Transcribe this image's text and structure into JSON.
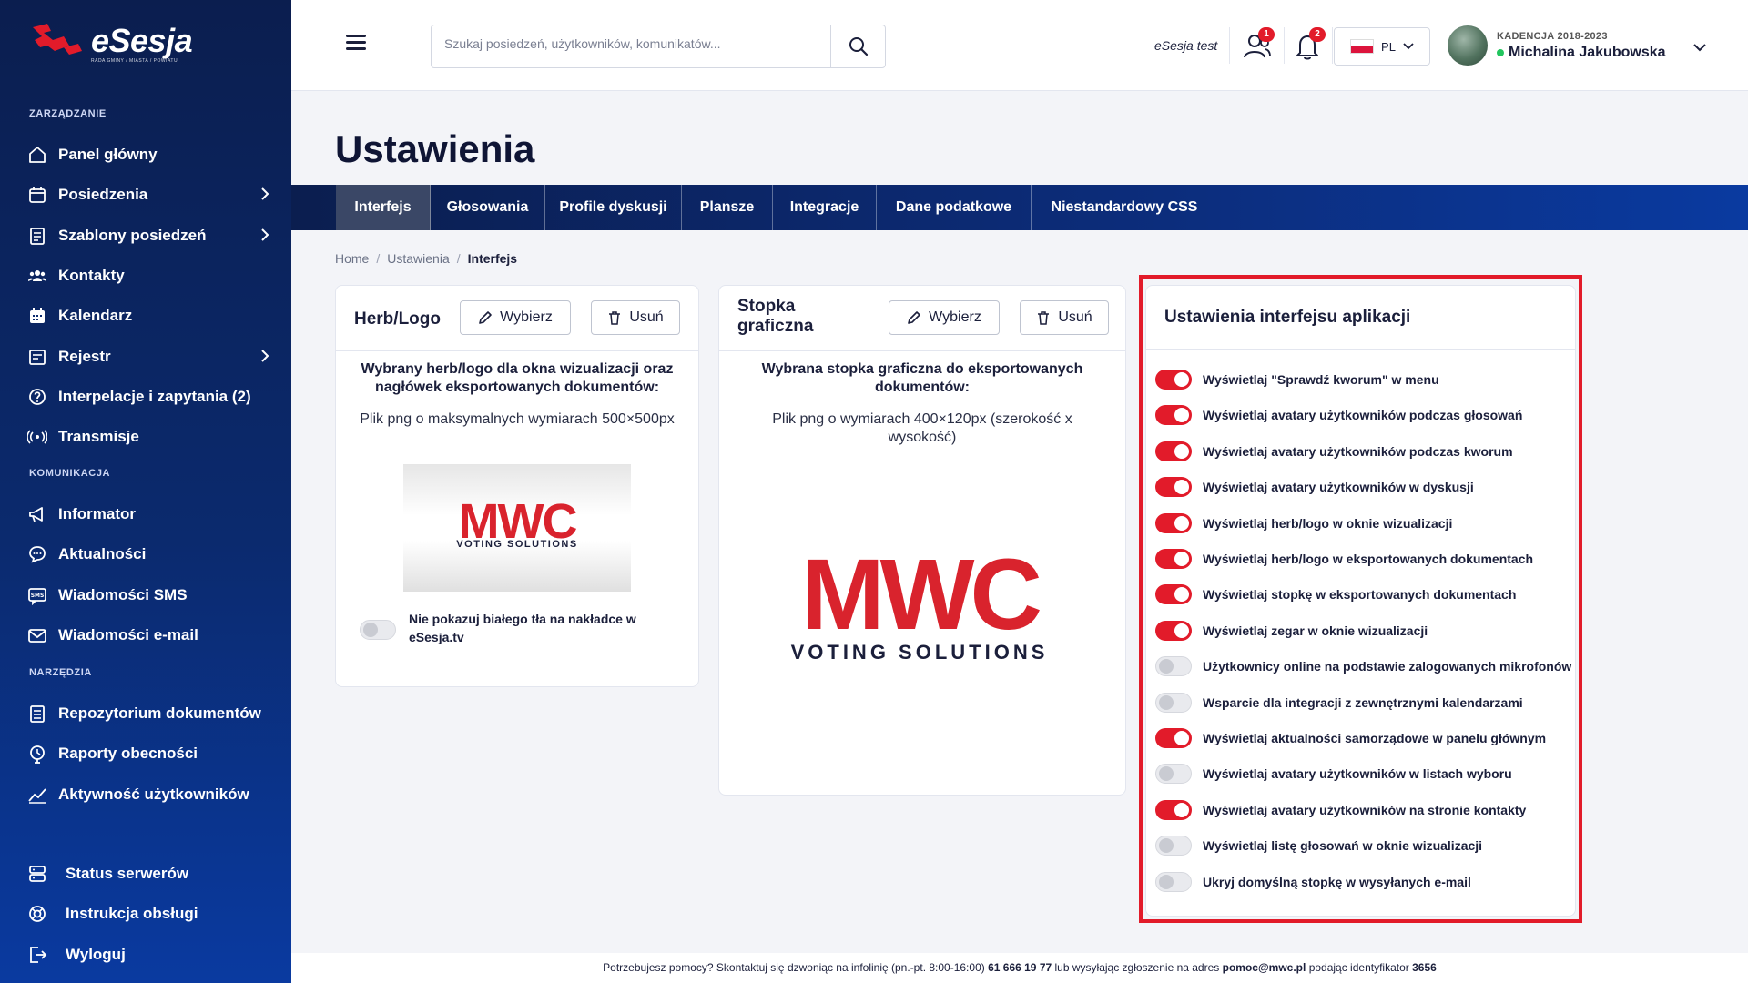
{
  "brand": {
    "name": "eSesja",
    "tagline": "RADA GMINY / MIASTA / POWIATU"
  },
  "sidebar": {
    "sections": [
      "ZARZĄDZANIE",
      "KOMUNIKACJA",
      "NARZĘDZIA"
    ],
    "management": [
      {
        "label": "Panel główny",
        "icon": "home-icon"
      },
      {
        "label": "Posiedzenia",
        "icon": "calendar-icon"
      },
      {
        "label": "Szablony posiedzeń",
        "icon": "template-icon"
      },
      {
        "label": "Kontakty",
        "icon": "contacts-icon"
      },
      {
        "label": "Kalendarz",
        "icon": "calendar-grid-icon"
      },
      {
        "label": "Rejestr",
        "icon": "register-icon"
      },
      {
        "label": "Interpelacje i zapytania (2)",
        "icon": "question-icon"
      },
      {
        "label": "Transmisje",
        "icon": "broadcast-icon"
      }
    ],
    "communication": [
      {
        "label": "Informator",
        "icon": "megaphone-icon"
      },
      {
        "label": "Aktualności",
        "icon": "chat-icon"
      },
      {
        "label": "Wiadomości SMS",
        "icon": "sms-icon"
      },
      {
        "label": "Wiadomości e-mail",
        "icon": "mail-icon"
      }
    ],
    "tools": [
      {
        "label": "Repozytorium dokumentów",
        "icon": "document-icon"
      },
      {
        "label": "Raporty obecności",
        "icon": "report-icon"
      },
      {
        "label": "Aktywność użytkowników",
        "icon": "chart-icon"
      }
    ],
    "bottom": [
      {
        "label": "Status serwerów",
        "icon": "server-icon"
      },
      {
        "label": "Instrukcja obsługi",
        "icon": "help-icon"
      },
      {
        "label": "Wyloguj",
        "icon": "logout-icon"
      }
    ]
  },
  "header": {
    "search_placeholder": "Szukaj posiedzeń, użytkowników, komunikatów...",
    "env_label": "eSesja test",
    "users_badge": "1",
    "notif_badge": "2",
    "lang": "PL",
    "user_term": "KADENCJA 2018-2023",
    "user_name": "Michalina Jakubowska"
  },
  "page": {
    "title": "Ustawienia",
    "tabs": [
      "Interfejs",
      "Głosowania",
      "Profile dyskusji",
      "Plansze",
      "Integracje",
      "Dane podatkowe",
      "Niestandardowy CSS"
    ],
    "active_tab": "Interfejs",
    "breadcrumb": [
      "Home",
      "Ustawienia",
      "Interfejs"
    ]
  },
  "logo_card": {
    "title": "Herb/Logo",
    "choose": "Wybierz",
    "remove": "Usuń",
    "desc_bold": "Wybrany herb/logo dla okna wizualizacji oraz nagłówek eksportowanych dokumentów:",
    "desc": "Plik png o maksymalnych wymiarach 500×500px",
    "logo_main": "MWC",
    "logo_sub": "VOTING SOLUTIONS",
    "toggle_label": "Nie pokazuj białego tła na nakładce w eSesja.tv",
    "toggle_on": false
  },
  "footer_card": {
    "title": "Stopka graficzna",
    "choose": "Wybierz",
    "remove": "Usuń",
    "desc_bold": "Wybrana stopka graficzna do eksportowanych dokumentów:",
    "desc": "Plik png o wymiarach 400×120px (szerokość x wysokość)",
    "logo_main": "MWC",
    "logo_sub": "VOTING SOLUTIONS"
  },
  "settings_card": {
    "title": "Ustawienia interfejsu aplikacji",
    "items": [
      {
        "label": "Wyświetlaj \"Sprawdź kworum\" w menu",
        "on": true
      },
      {
        "label": "Wyświetlaj avatary użytkowników podczas głosowań",
        "on": true
      },
      {
        "label": "Wyświetlaj avatary użytkowników podczas kworum",
        "on": true
      },
      {
        "label": "Wyświetlaj avatary użytkowników w dyskusji",
        "on": true
      },
      {
        "label": "Wyświetlaj herb/logo w oknie wizualizacji",
        "on": true
      },
      {
        "label": "Wyświetlaj herb/logo w eksportowanych dokumentach",
        "on": true
      },
      {
        "label": "Wyświetlaj stopkę w eksportowanych dokumentach",
        "on": true
      },
      {
        "label": "Wyświetlaj zegar w oknie wizualizacji",
        "on": true
      },
      {
        "label": "Użytkownicy online na podstawie zalogowanych mikrofonów",
        "on": false
      },
      {
        "label": "Wsparcie dla integracji z zewnętrznymi kalendarzami",
        "on": false
      },
      {
        "label": "Wyświetlaj aktualności samorządowe w panelu głównym",
        "on": true
      },
      {
        "label": "Wyświetlaj avatary użytkowników w listach wyboru",
        "on": false
      },
      {
        "label": "Wyświetlaj avatary użytkowników na stronie kontakty",
        "on": true
      },
      {
        "label": "Wyświetlaj listę głosowań w oknie wizualizacji",
        "on": false
      },
      {
        "label": "Ukryj domyślną stopkę w wysyłanych e-mail",
        "on": false
      }
    ]
  },
  "footer": {
    "text1": "Potrzebujesz pomocy? Skontaktuj się dzwoniąc na infolinię (pn.-pt. 8:00-16:00)",
    "phone": "61 666 19 77",
    "text2": "lub wysyłając zgłoszenie na adres",
    "email": "pomoc@mwc.pl",
    "text3": "podając identyfikator",
    "id": "3656"
  },
  "colors": {
    "accent": "#e21b2a",
    "sidebar": "#0b2a6e",
    "toggle_on": "#e21b2a"
  }
}
